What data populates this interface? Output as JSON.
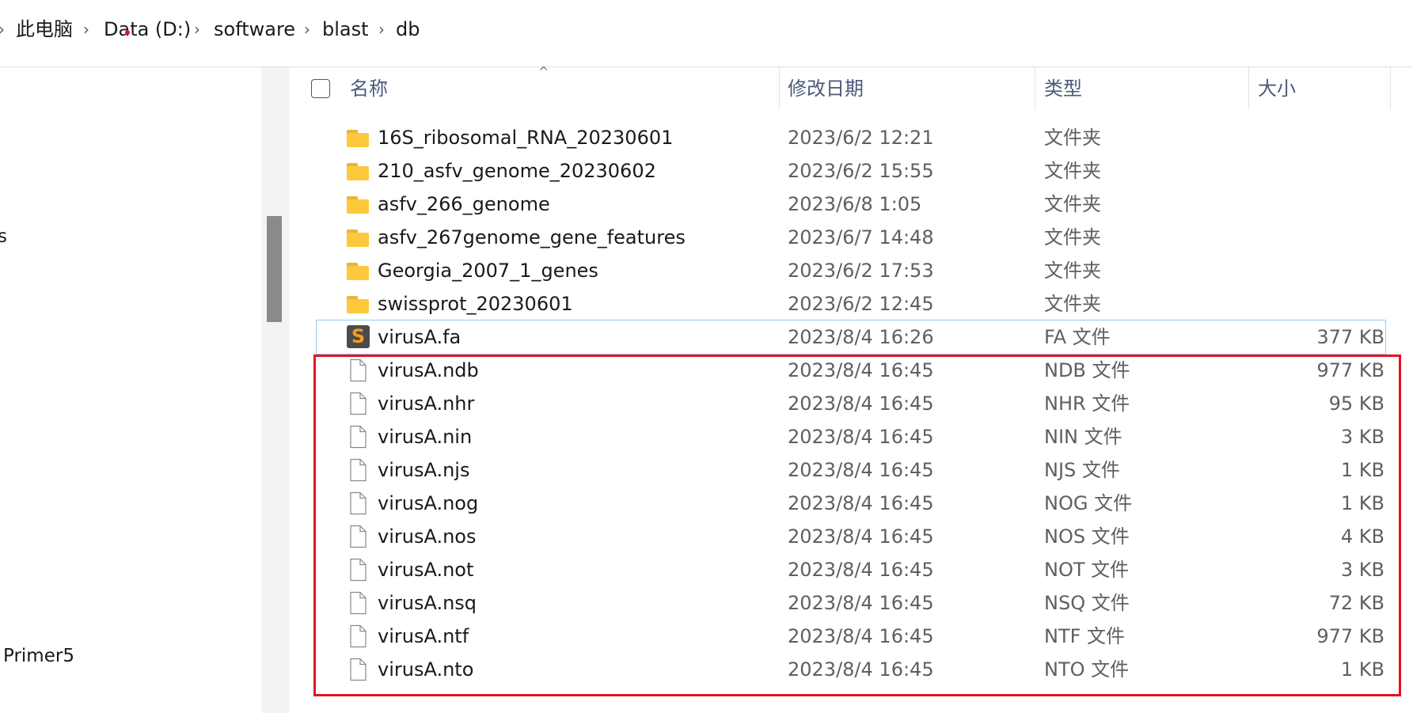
{
  "address_bar": {
    "crumbs": [
      "此电脑",
      "Data (D:)",
      "software",
      "blast",
      "db"
    ]
  },
  "nav": {
    "items": [
      "s",
      "Primer5"
    ]
  },
  "columns": {
    "name": "名称",
    "date": "修改日期",
    "type": "类型",
    "size": "大小"
  },
  "files": [
    {
      "name": "16S_ribosomal_RNA_20230601",
      "date": "2023/6/2 12:21",
      "type": "文件夹",
      "size": "",
      "icon": "folder-icon"
    },
    {
      "name": "210_asfv_genome_20230602",
      "date": "2023/6/2 15:55",
      "type": "文件夹",
      "size": "",
      "icon": "folder-icon"
    },
    {
      "name": "asfv_266_genome",
      "date": "2023/6/8 1:05",
      "type": "文件夹",
      "size": "",
      "icon": "folder-icon"
    },
    {
      "name": "asfv_267genome_gene_features",
      "date": "2023/6/7 14:48",
      "type": "文件夹",
      "size": "",
      "icon": "folder-icon"
    },
    {
      "name": "Georgia_2007_1_genes",
      "date": "2023/6/2 17:53",
      "type": "文件夹",
      "size": "",
      "icon": "folder-icon"
    },
    {
      "name": "swissprot_20230601",
      "date": "2023/6/2 12:45",
      "type": "文件夹",
      "size": "",
      "icon": "folder-icon"
    },
    {
      "name": "virusA.fa",
      "date": "2023/8/4 16:26",
      "type": "FA 文件",
      "size": "377 KB",
      "icon": "sublime-text-icon"
    },
    {
      "name": "virusA.ndb",
      "date": "2023/8/4 16:45",
      "type": "NDB 文件",
      "size": "977 KB",
      "icon": "file-icon"
    },
    {
      "name": "virusA.nhr",
      "date": "2023/8/4 16:45",
      "type": "NHR 文件",
      "size": "95 KB",
      "icon": "file-icon"
    },
    {
      "name": "virusA.nin",
      "date": "2023/8/4 16:45",
      "type": "NIN 文件",
      "size": "3 KB",
      "icon": "file-icon"
    },
    {
      "name": "virusA.njs",
      "date": "2023/8/4 16:45",
      "type": "NJS 文件",
      "size": "1 KB",
      "icon": "file-icon"
    },
    {
      "name": "virusA.nog",
      "date": "2023/8/4 16:45",
      "type": "NOG 文件",
      "size": "1 KB",
      "icon": "file-icon"
    },
    {
      "name": "virusA.nos",
      "date": "2023/8/4 16:45",
      "type": "NOS 文件",
      "size": "4 KB",
      "icon": "file-icon"
    },
    {
      "name": "virusA.not",
      "date": "2023/8/4 16:45",
      "type": "NOT 文件",
      "size": "3 KB",
      "icon": "file-icon"
    },
    {
      "name": "virusA.nsq",
      "date": "2023/8/4 16:45",
      "type": "NSQ 文件",
      "size": "72 KB",
      "icon": "file-icon"
    },
    {
      "name": "virusA.ntf",
      "date": "2023/8/4 16:45",
      "type": "NTF 文件",
      "size": "977 KB",
      "icon": "file-icon"
    },
    {
      "name": "virusA.nto",
      "date": "2023/8/4 16:45",
      "type": "NTO 文件",
      "size": "1 KB",
      "icon": "file-icon"
    }
  ],
  "colors": {
    "highlight": "#e81123",
    "folder": "#fcc93a",
    "header_text": "#4a5b79"
  }
}
